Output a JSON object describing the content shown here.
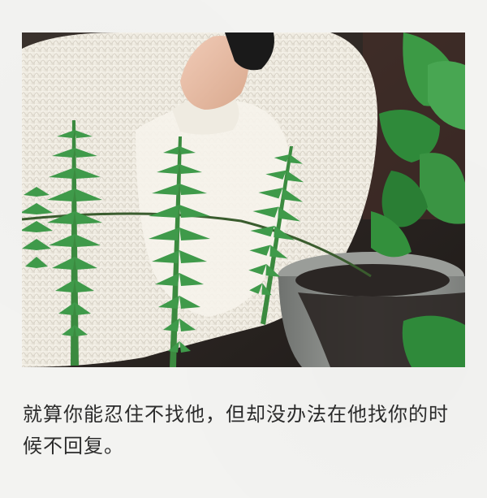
{
  "photo": {
    "subject": "photo",
    "colors": {
      "sweater": "#f3f0e8",
      "fern": "#3f9a4a",
      "leaf": "#2f8a3a",
      "pot": "#8e918e",
      "soil": "#2b2624",
      "background": "#2a2523"
    }
  },
  "caption": {
    "text": "就算你能忍住不找他，但却没办法在他找你的时候不回复。"
  }
}
